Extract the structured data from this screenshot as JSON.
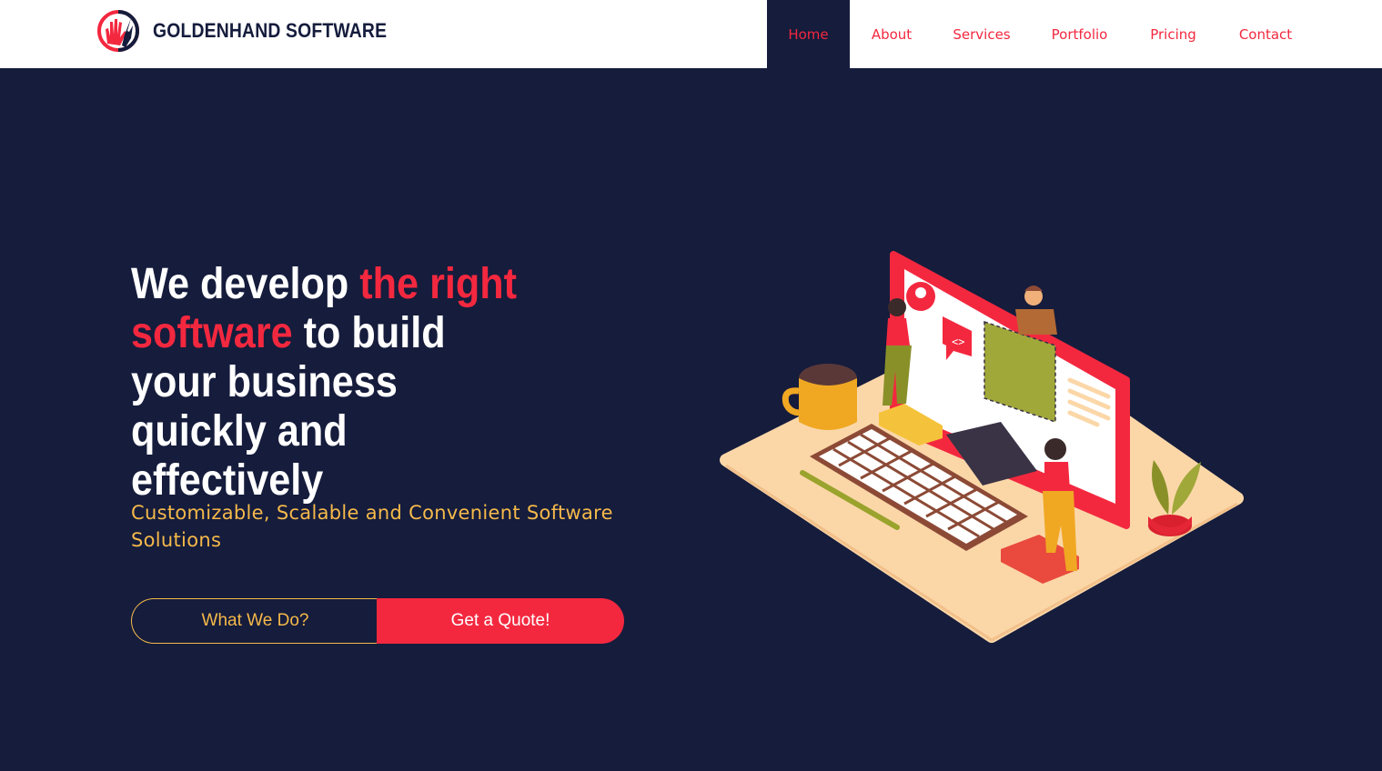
{
  "brand": {
    "name": "GOLDENHAND SOFTWARE"
  },
  "nav": {
    "items": [
      {
        "label": "Home",
        "active": true
      },
      {
        "label": "About"
      },
      {
        "label": "Services"
      },
      {
        "label": "Portfolio"
      },
      {
        "label": "Pricing"
      },
      {
        "label": "Contact"
      }
    ]
  },
  "hero": {
    "title_part1": "We develop ",
    "title_highlight": "the right software",
    "title_part2": " to build your business quickly and effectively",
    "subtitle": "Customizable, Scalable and Convenient Software Solutions",
    "cta_secondary": "What We Do?",
    "cta_primary": "Get a Quote!"
  },
  "colors": {
    "navy": "#151c3c",
    "accent_red": "#f3283f",
    "gold": "#f5b94a"
  }
}
